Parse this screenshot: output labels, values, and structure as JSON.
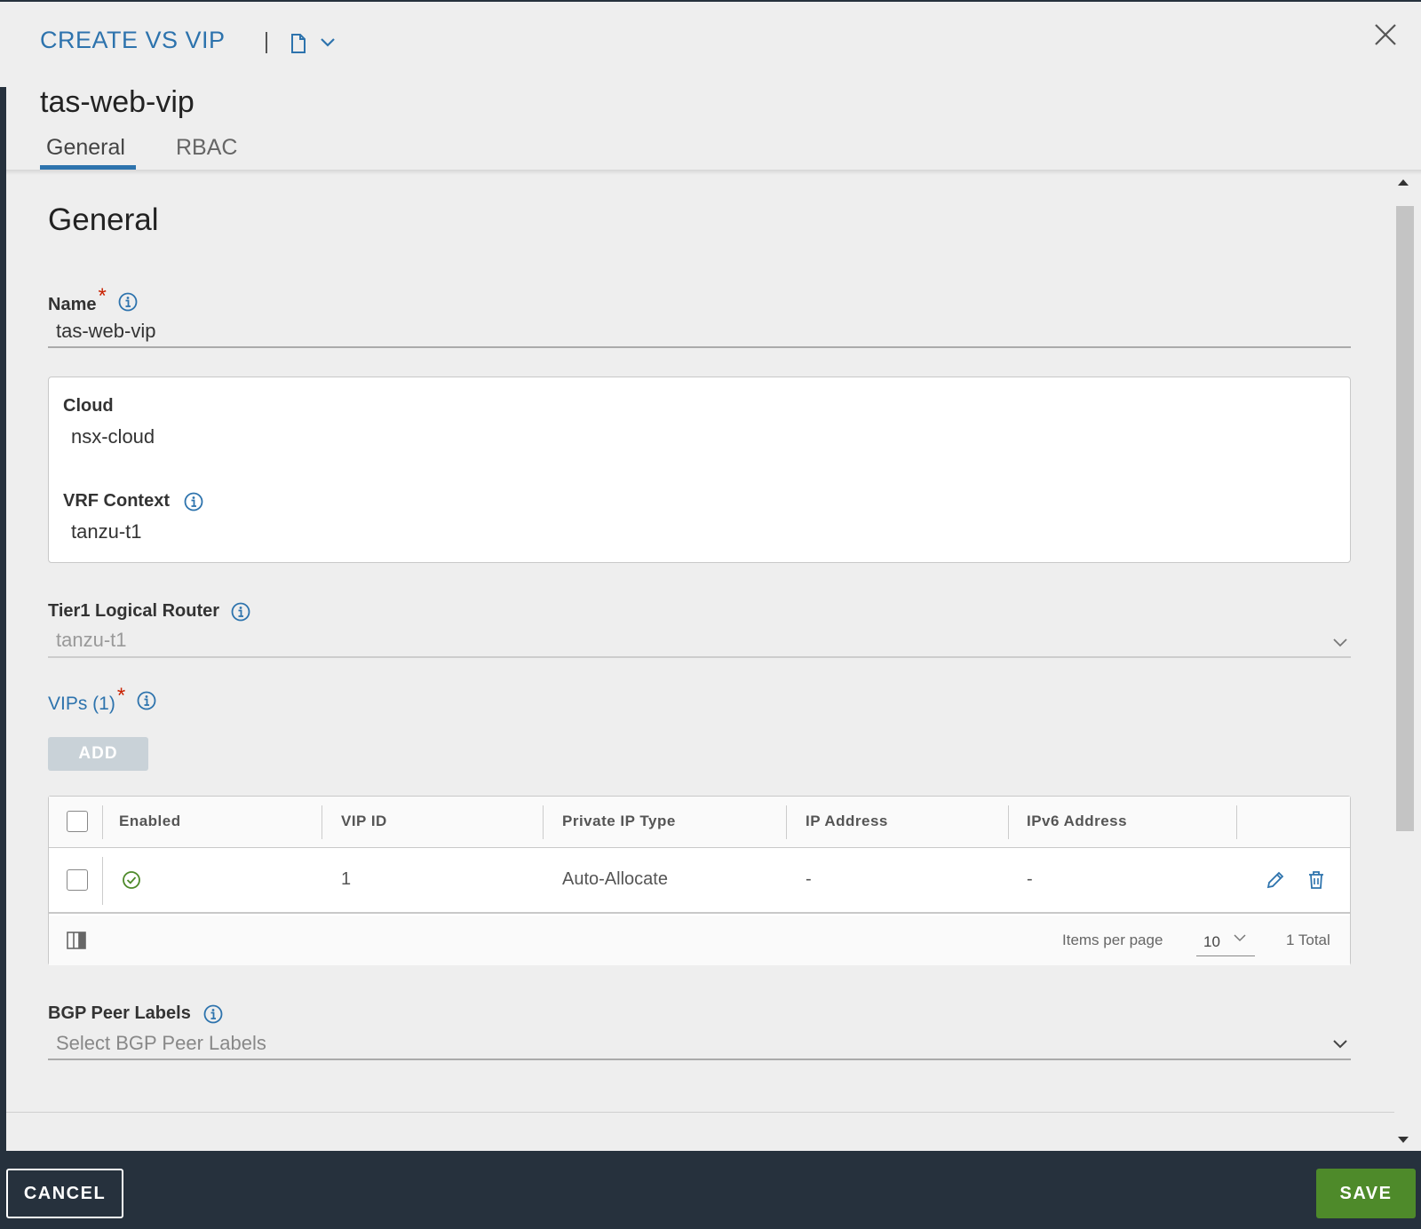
{
  "header": {
    "title": "CREATE VS VIP",
    "object_name": "tas-web-vip",
    "icons": [
      "document-icon",
      "chevron-down-icon",
      "close-icon"
    ]
  },
  "tabs": [
    {
      "label": "General",
      "active": true
    },
    {
      "label": "RBAC",
      "active": false
    }
  ],
  "section": {
    "title": "General"
  },
  "fields": {
    "name": {
      "label": "Name",
      "required_mark": "*",
      "value": "tas-web-vip"
    },
    "cloud": {
      "label": "Cloud",
      "value": "nsx-cloud"
    },
    "vrf": {
      "label": "VRF Context",
      "value": "tanzu-t1"
    },
    "tier1": {
      "label": "Tier1 Logical Router",
      "value": "tanzu-t1"
    },
    "vips": {
      "label": "VIPs (1)",
      "required_mark": "*"
    },
    "bgp": {
      "label": "BGP Peer Labels",
      "placeholder": "Select BGP Peer Labels"
    }
  },
  "add_button": {
    "label": "ADD"
  },
  "grid": {
    "columns": [
      "Enabled",
      "VIP ID",
      "Private IP Type",
      "IP Address",
      "IPv6 Address"
    ],
    "rows": [
      {
        "enabled": true,
        "vip_id": "1",
        "private_ip_type": "Auto-Allocate",
        "ip_address": "-",
        "ipv6_address": "-"
      }
    ],
    "footer": {
      "items_per_page_label": "Items per page",
      "items_per_page": "10",
      "total": "1 Total"
    }
  },
  "footer": {
    "cancel_label": "CANCEL",
    "save_label": "SAVE"
  },
  "colors": {
    "accent": "#2d73ad",
    "save": "#4e8a2a",
    "footer_bg": "#26313d",
    "enabled_ok": "#4e8a2a",
    "required": "#c92100"
  }
}
